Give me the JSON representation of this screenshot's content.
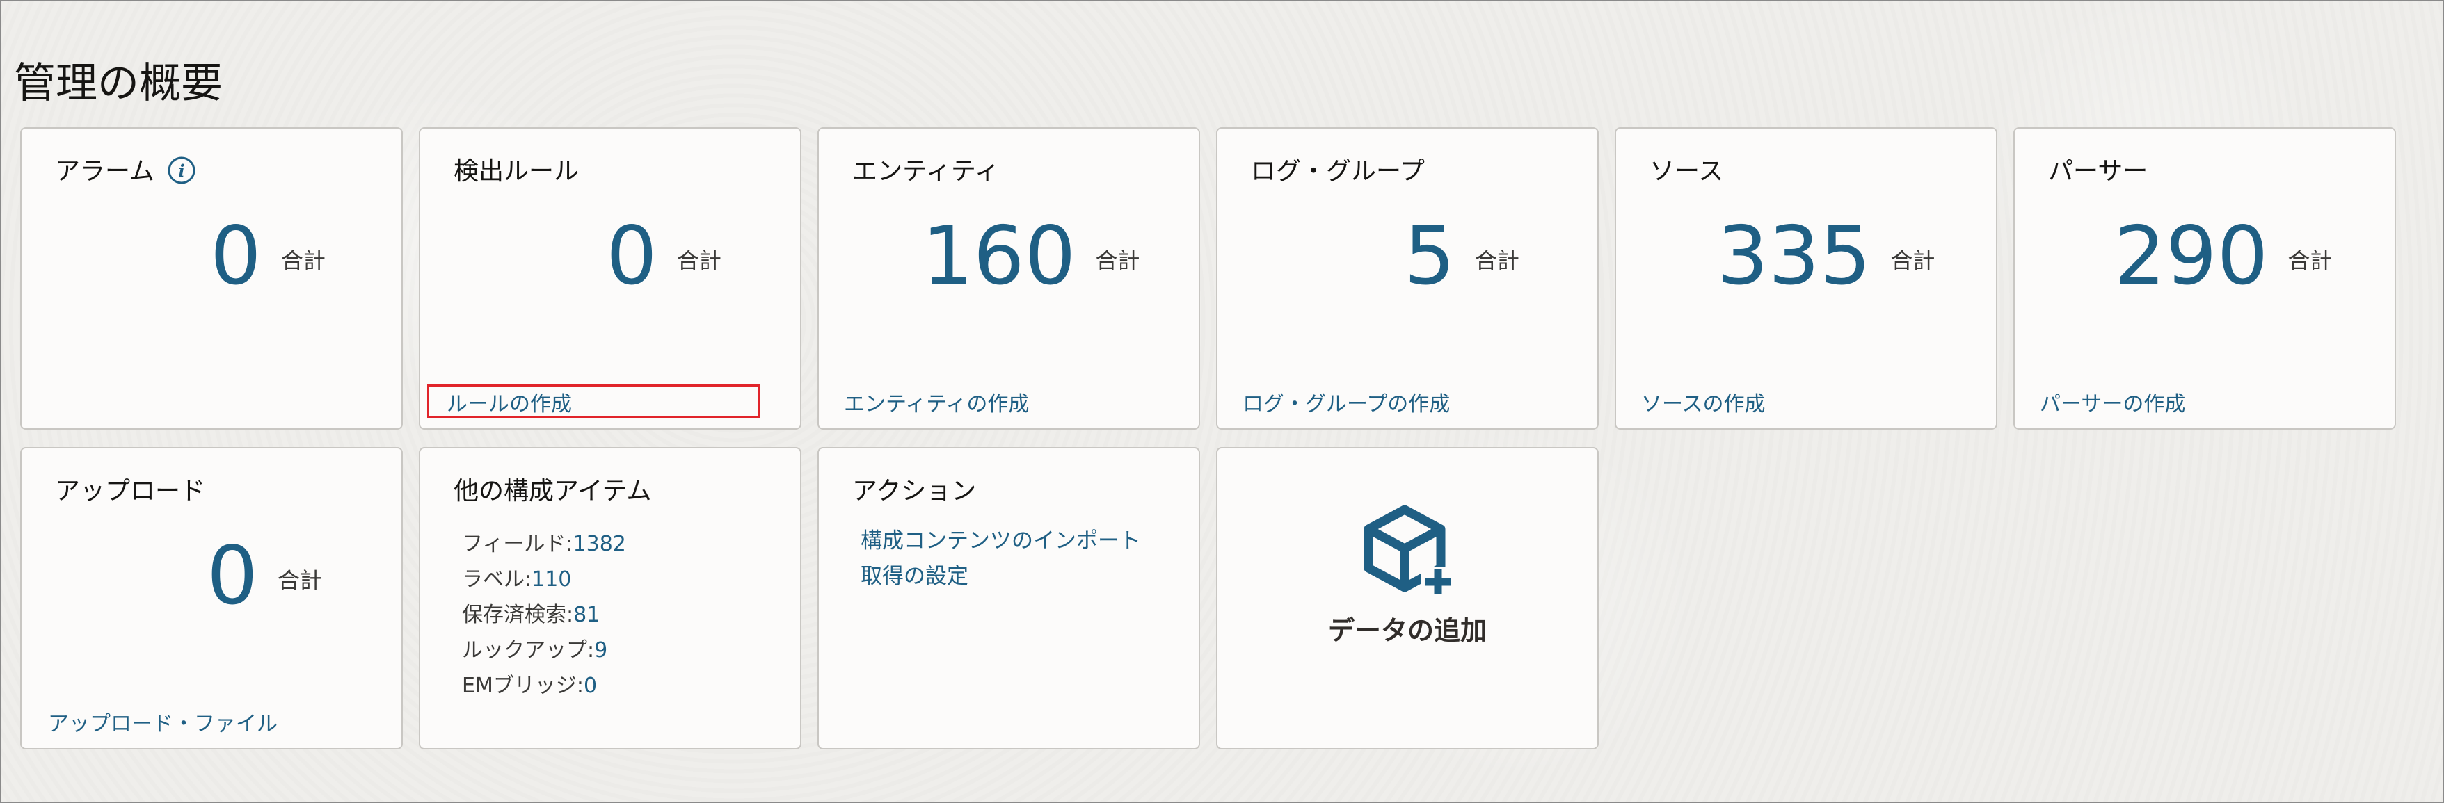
{
  "page": {
    "title": "管理の概要"
  },
  "colors": {
    "accent": "#1f5f84",
    "highlight": "#e1242a",
    "card_bg": "#fcfbfa",
    "card_border": "#c9c7c3"
  },
  "cards": {
    "alarms": {
      "title": "アラーム",
      "icon": "info-icon",
      "value": "0",
      "unit": "合計"
    },
    "rules": {
      "title": "検出ルール",
      "value": "0",
      "unit": "合計",
      "link": "ルールの作成"
    },
    "entities": {
      "title": "エンティティ",
      "value": "160",
      "unit": "合計",
      "link": "エンティティの作成"
    },
    "log_groups": {
      "title": "ログ・グループ",
      "value": "5",
      "unit": "合計",
      "link": "ログ・グループの作成"
    },
    "sources": {
      "title": "ソース",
      "value": "335",
      "unit": "合計",
      "link": "ソースの作成"
    },
    "parsers": {
      "title": "パーサー",
      "value": "290",
      "unit": "合計",
      "link": "パーサーの作成"
    },
    "uploads": {
      "title": "アップロード",
      "value": "0",
      "unit": "合計",
      "link": "アップロード・ファイル"
    },
    "other_items": {
      "title": "他の構成アイテム",
      "stats": [
        {
          "label": "フィールド:",
          "value": "1382"
        },
        {
          "label": "ラベル:",
          "value": "110"
        },
        {
          "label": "保存済検索:",
          "value": "81"
        },
        {
          "label": "ルックアップ:",
          "value": "9"
        },
        {
          "label": "EMブリッジ:",
          "value": "0"
        }
      ]
    },
    "actions": {
      "title": "アクション",
      "links": [
        "構成コンテンツのインポート",
        "取得の設定"
      ]
    },
    "add_data": {
      "label": "データの追加",
      "icon": "cube-plus-icon"
    }
  }
}
